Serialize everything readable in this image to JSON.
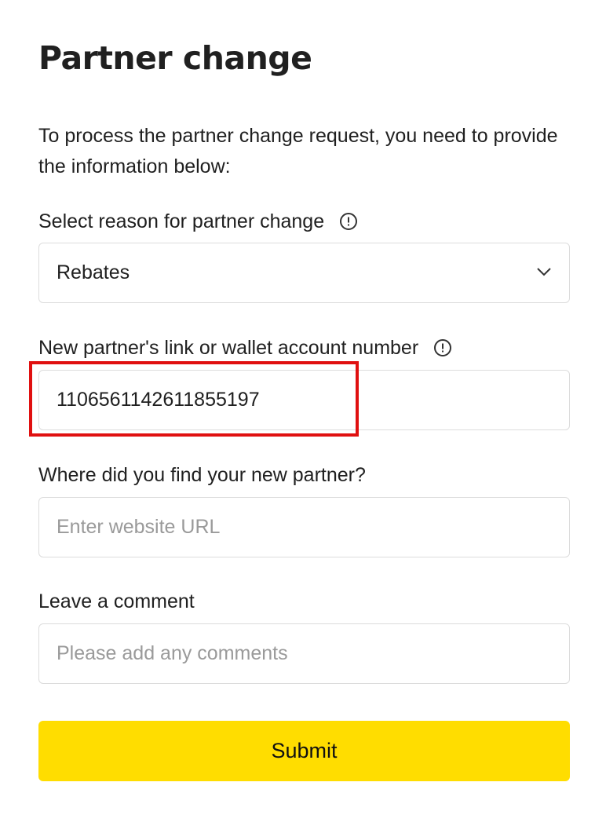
{
  "form": {
    "title": "Partner change",
    "intro": "To process the partner change request, you need to provide the information below:",
    "reason": {
      "label": "Select reason for partner change",
      "value": "Rebates",
      "info_icon": "info-circle-icon",
      "dropdown_icon": "chevron-down-icon"
    },
    "partner_link": {
      "label": "New partner's link or wallet account number",
      "value": "1106561142611855197",
      "info_icon": "info-circle-icon"
    },
    "source": {
      "label": "Where did you find your new partner?",
      "placeholder": "Enter website URL"
    },
    "comment": {
      "label": "Leave a comment",
      "placeholder": "Please add any comments"
    },
    "submit_label": "Submit"
  },
  "colors": {
    "submit_background": "#ffdd00",
    "highlight_border": "#e01010",
    "field_border": "#dcdcdc",
    "placeholder_text": "#9a9a9a"
  }
}
